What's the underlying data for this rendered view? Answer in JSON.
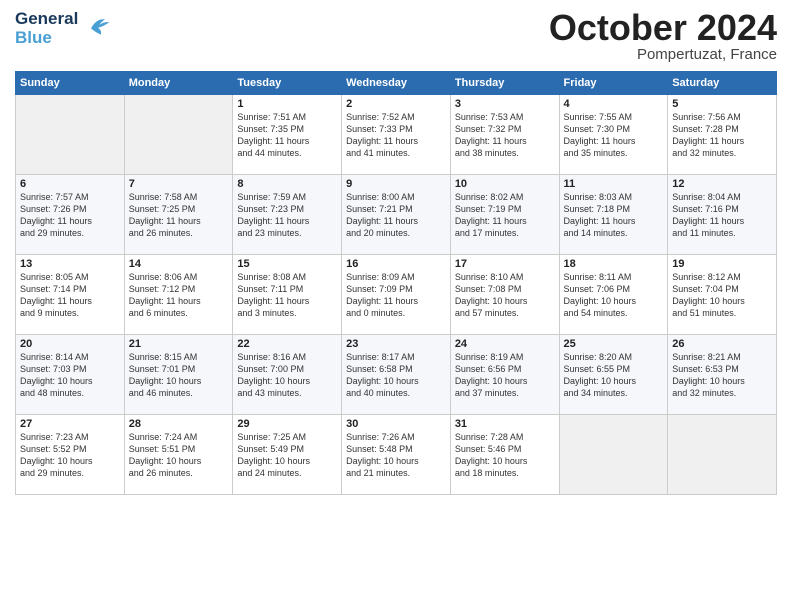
{
  "header": {
    "logo_general": "General",
    "logo_blue": "Blue",
    "month_title": "October 2024",
    "location": "Pompertuzat, France"
  },
  "days_of_week": [
    "Sunday",
    "Monday",
    "Tuesday",
    "Wednesday",
    "Thursday",
    "Friday",
    "Saturday"
  ],
  "weeks": [
    [
      {
        "day": "",
        "info": ""
      },
      {
        "day": "",
        "info": ""
      },
      {
        "day": "1",
        "info": "Sunrise: 7:51 AM\nSunset: 7:35 PM\nDaylight: 11 hours\nand 44 minutes."
      },
      {
        "day": "2",
        "info": "Sunrise: 7:52 AM\nSunset: 7:33 PM\nDaylight: 11 hours\nand 41 minutes."
      },
      {
        "day": "3",
        "info": "Sunrise: 7:53 AM\nSunset: 7:32 PM\nDaylight: 11 hours\nand 38 minutes."
      },
      {
        "day": "4",
        "info": "Sunrise: 7:55 AM\nSunset: 7:30 PM\nDaylight: 11 hours\nand 35 minutes."
      },
      {
        "day": "5",
        "info": "Sunrise: 7:56 AM\nSunset: 7:28 PM\nDaylight: 11 hours\nand 32 minutes."
      }
    ],
    [
      {
        "day": "6",
        "info": "Sunrise: 7:57 AM\nSunset: 7:26 PM\nDaylight: 11 hours\nand 29 minutes."
      },
      {
        "day": "7",
        "info": "Sunrise: 7:58 AM\nSunset: 7:25 PM\nDaylight: 11 hours\nand 26 minutes."
      },
      {
        "day": "8",
        "info": "Sunrise: 7:59 AM\nSunset: 7:23 PM\nDaylight: 11 hours\nand 23 minutes."
      },
      {
        "day": "9",
        "info": "Sunrise: 8:00 AM\nSunset: 7:21 PM\nDaylight: 11 hours\nand 20 minutes."
      },
      {
        "day": "10",
        "info": "Sunrise: 8:02 AM\nSunset: 7:19 PM\nDaylight: 11 hours\nand 17 minutes."
      },
      {
        "day": "11",
        "info": "Sunrise: 8:03 AM\nSunset: 7:18 PM\nDaylight: 11 hours\nand 14 minutes."
      },
      {
        "day": "12",
        "info": "Sunrise: 8:04 AM\nSunset: 7:16 PM\nDaylight: 11 hours\nand 11 minutes."
      }
    ],
    [
      {
        "day": "13",
        "info": "Sunrise: 8:05 AM\nSunset: 7:14 PM\nDaylight: 11 hours\nand 9 minutes."
      },
      {
        "day": "14",
        "info": "Sunrise: 8:06 AM\nSunset: 7:12 PM\nDaylight: 11 hours\nand 6 minutes."
      },
      {
        "day": "15",
        "info": "Sunrise: 8:08 AM\nSunset: 7:11 PM\nDaylight: 11 hours\nand 3 minutes."
      },
      {
        "day": "16",
        "info": "Sunrise: 8:09 AM\nSunset: 7:09 PM\nDaylight: 11 hours\nand 0 minutes."
      },
      {
        "day": "17",
        "info": "Sunrise: 8:10 AM\nSunset: 7:08 PM\nDaylight: 10 hours\nand 57 minutes."
      },
      {
        "day": "18",
        "info": "Sunrise: 8:11 AM\nSunset: 7:06 PM\nDaylight: 10 hours\nand 54 minutes."
      },
      {
        "day": "19",
        "info": "Sunrise: 8:12 AM\nSunset: 7:04 PM\nDaylight: 10 hours\nand 51 minutes."
      }
    ],
    [
      {
        "day": "20",
        "info": "Sunrise: 8:14 AM\nSunset: 7:03 PM\nDaylight: 10 hours\nand 48 minutes."
      },
      {
        "day": "21",
        "info": "Sunrise: 8:15 AM\nSunset: 7:01 PM\nDaylight: 10 hours\nand 46 minutes."
      },
      {
        "day": "22",
        "info": "Sunrise: 8:16 AM\nSunset: 7:00 PM\nDaylight: 10 hours\nand 43 minutes."
      },
      {
        "day": "23",
        "info": "Sunrise: 8:17 AM\nSunset: 6:58 PM\nDaylight: 10 hours\nand 40 minutes."
      },
      {
        "day": "24",
        "info": "Sunrise: 8:19 AM\nSunset: 6:56 PM\nDaylight: 10 hours\nand 37 minutes."
      },
      {
        "day": "25",
        "info": "Sunrise: 8:20 AM\nSunset: 6:55 PM\nDaylight: 10 hours\nand 34 minutes."
      },
      {
        "day": "26",
        "info": "Sunrise: 8:21 AM\nSunset: 6:53 PM\nDaylight: 10 hours\nand 32 minutes."
      }
    ],
    [
      {
        "day": "27",
        "info": "Sunrise: 7:23 AM\nSunset: 5:52 PM\nDaylight: 10 hours\nand 29 minutes."
      },
      {
        "day": "28",
        "info": "Sunrise: 7:24 AM\nSunset: 5:51 PM\nDaylight: 10 hours\nand 26 minutes."
      },
      {
        "day": "29",
        "info": "Sunrise: 7:25 AM\nSunset: 5:49 PM\nDaylight: 10 hours\nand 24 minutes."
      },
      {
        "day": "30",
        "info": "Sunrise: 7:26 AM\nSunset: 5:48 PM\nDaylight: 10 hours\nand 21 minutes."
      },
      {
        "day": "31",
        "info": "Sunrise: 7:28 AM\nSunset: 5:46 PM\nDaylight: 10 hours\nand 18 minutes."
      },
      {
        "day": "",
        "info": ""
      },
      {
        "day": "",
        "info": ""
      }
    ]
  ]
}
